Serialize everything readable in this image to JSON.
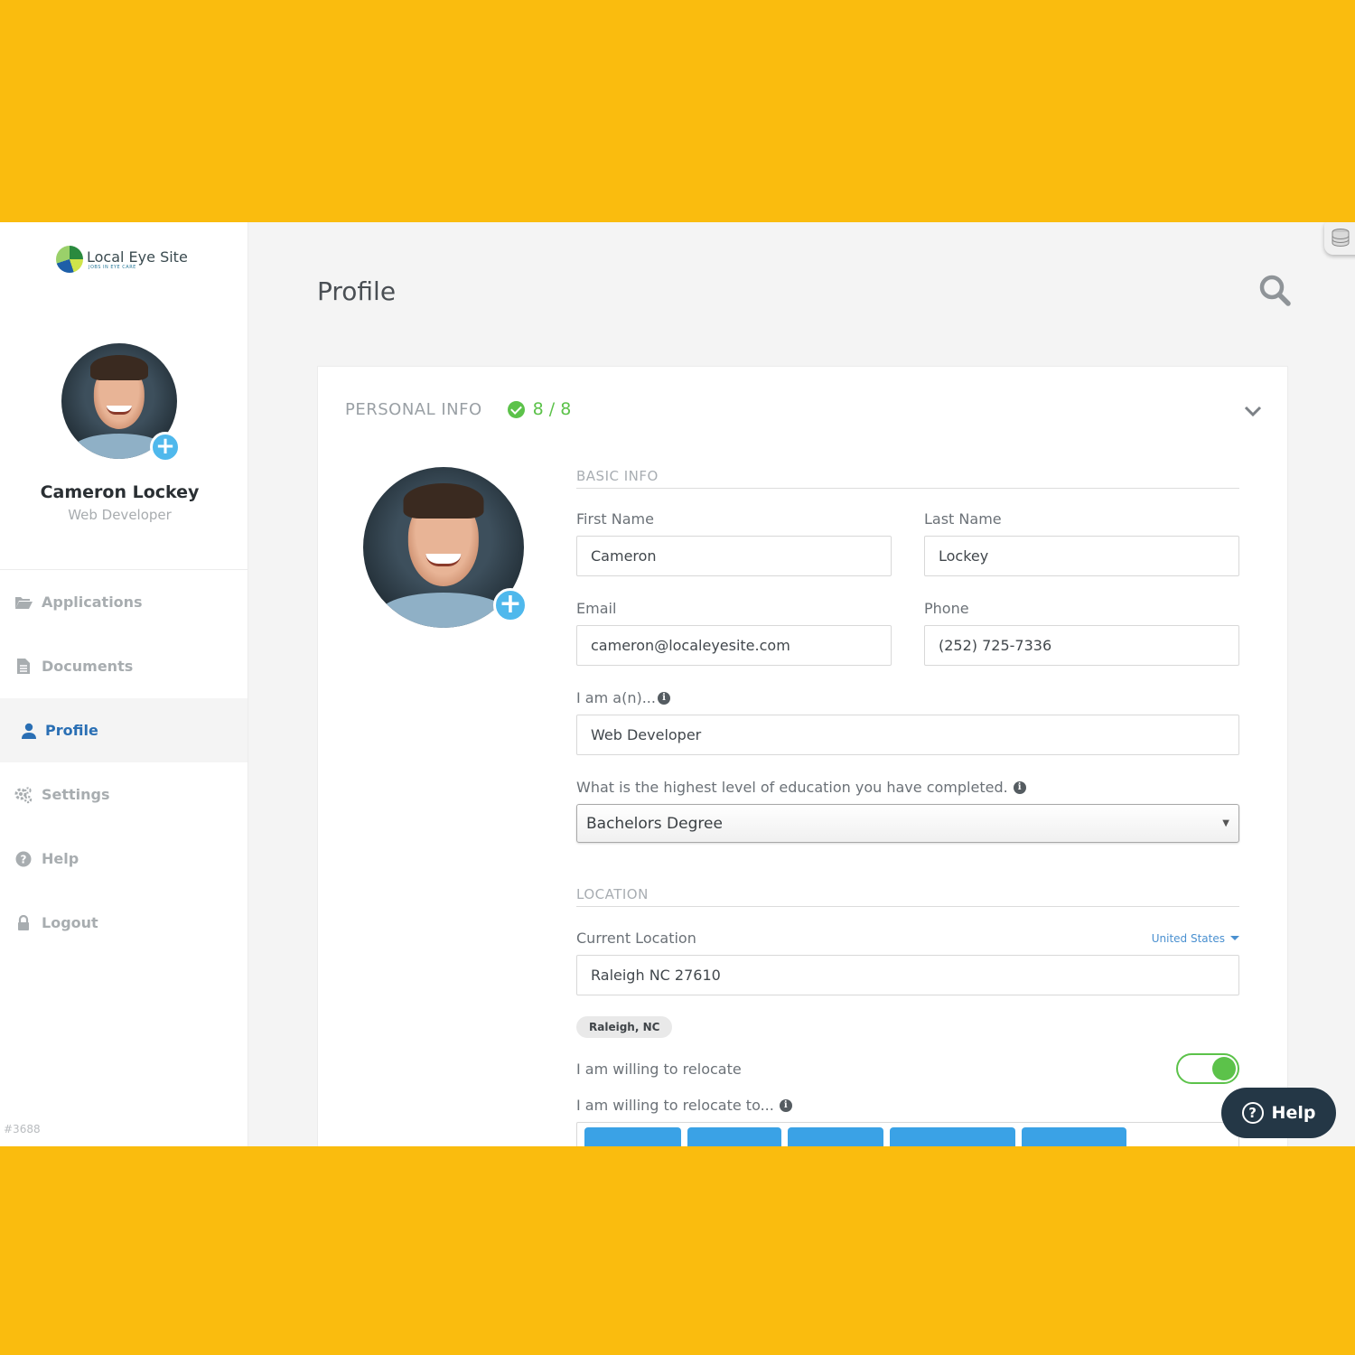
{
  "brand": {
    "name": "Local Eye Site",
    "tagline": "JOBS IN EYE CARE"
  },
  "user": {
    "name": "Cameron Lockey",
    "role": "Web Developer"
  },
  "nav": [
    {
      "label": "Applications",
      "icon": "folder-open-icon",
      "active": false
    },
    {
      "label": "Documents",
      "icon": "document-icon",
      "active": false
    },
    {
      "label": "Profile",
      "icon": "user-icon",
      "active": true
    },
    {
      "label": "Settings",
      "icon": "gears-icon",
      "active": false
    },
    {
      "label": "Help",
      "icon": "question-circle-icon",
      "active": false
    },
    {
      "label": "Logout",
      "icon": "lock-icon",
      "active": false
    }
  ],
  "build_id": "#3688",
  "page": {
    "title": "Profile"
  },
  "personal_info": {
    "title": "PERSONAL INFO",
    "progress": "8 / 8",
    "basic_info_title": "BASIC INFO",
    "first_name": {
      "label": "First Name",
      "value": "Cameron"
    },
    "last_name": {
      "label": "Last Name",
      "value": "Lockey"
    },
    "email": {
      "label": "Email",
      "value": "cameron@localeyesite.com"
    },
    "phone": {
      "label": "Phone",
      "value": "(252) 725-7336"
    },
    "occupation": {
      "label": "I am a(n)...",
      "value": "Web Developer"
    },
    "education": {
      "label": "What is the highest level of education you have completed.",
      "value": "Bachelors Degree"
    },
    "location_title": "LOCATION",
    "current_location": {
      "label": "Current Location",
      "country": "United States",
      "value": "Raleigh NC 27610",
      "chip": "Raleigh, NC"
    },
    "relocate": {
      "label": "I am willing to relocate",
      "enabled": true
    },
    "relocate_to": {
      "label": "I am willing to relocate to..."
    }
  },
  "help_button": {
    "label": "Help"
  },
  "colors": {
    "accent": "#2a6fb4",
    "success": "#5cc24a",
    "badge": "#4fb8ec",
    "tag": "#3aa2e6",
    "background": "#FABC0E",
    "help": "#243746"
  }
}
